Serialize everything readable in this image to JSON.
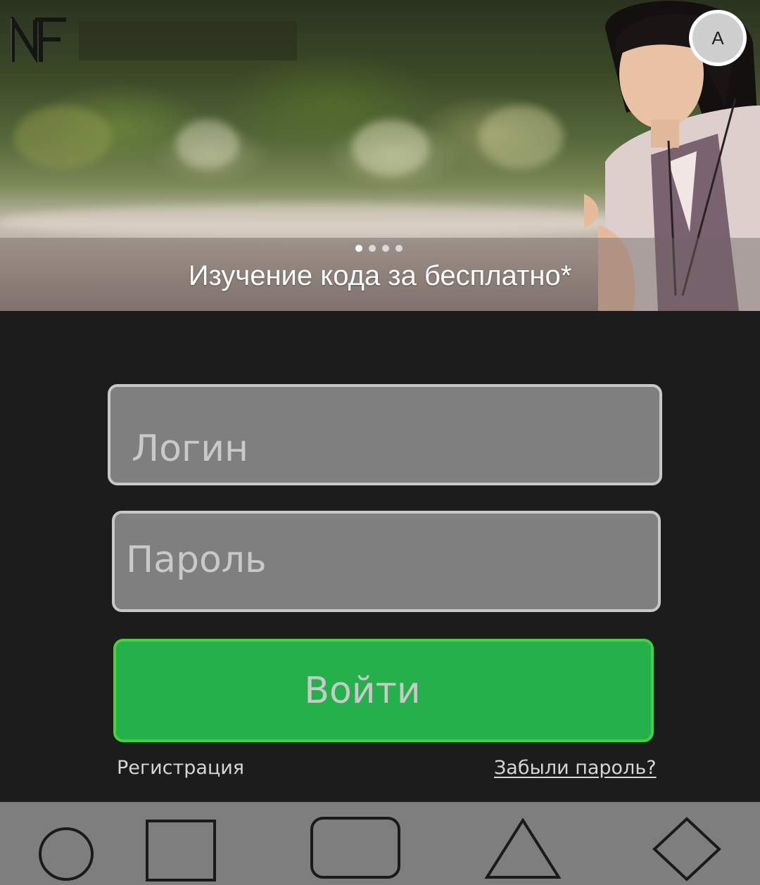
{
  "hero": {
    "caption": "Изучение кода за бесплатно*",
    "slides": 4,
    "active_slide": 1
  },
  "header": {
    "logo_text": "NF",
    "avatar_letter": "A"
  },
  "form": {
    "login_placeholder": "Логин",
    "password_placeholder": "Пароль",
    "submit_label": "Войти",
    "register_label": "Регистрация",
    "forgot_label": "Забыли пароль?"
  },
  "bottom_nav": {
    "items": [
      "circle-icon",
      "square-icon",
      "rounded-rect-icon",
      "triangle-icon",
      "diamond-icon"
    ]
  },
  "colors": {
    "background": "#1c1c1c",
    "field_bg": "#7f7f7f",
    "button_green": "#24b04a",
    "button_border": "#46d13c",
    "bottom_bar": "#7e7e7e"
  }
}
